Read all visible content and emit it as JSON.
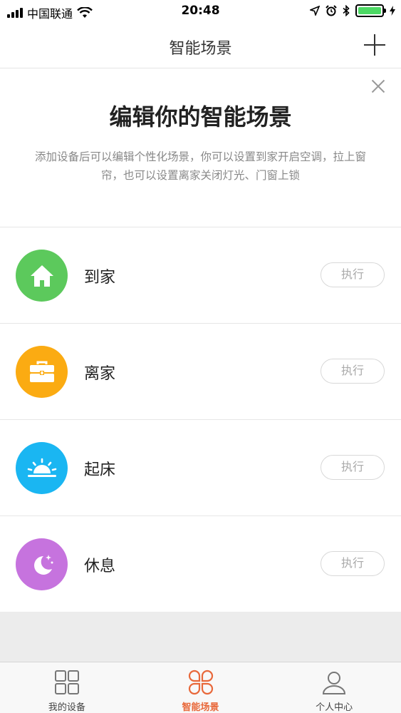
{
  "status_bar": {
    "carrier": "中国联通",
    "time": "20:48",
    "battery_color": "#4cd964"
  },
  "nav": {
    "title": "智能场景",
    "add_icon": "plus-icon"
  },
  "intro": {
    "title": "编辑你的智能场景",
    "description": "添加设备后可以编辑个性化场景，你可以设置到家开启空调，拉上窗帘，也可以设置离家关闭灯光、门窗上锁",
    "close_icon": "close-icon"
  },
  "scenes": [
    {
      "name": "到家",
      "action": "执行",
      "icon": "home-icon",
      "color": "#5cc95c"
    },
    {
      "name": "离家",
      "action": "执行",
      "icon": "briefcase-icon",
      "color": "#fbab12"
    },
    {
      "name": "起床",
      "action": "执行",
      "icon": "sunrise-icon",
      "color": "#1ab6f2"
    },
    {
      "name": "休息",
      "action": "执行",
      "icon": "moon-icon",
      "color": "#c673de"
    }
  ],
  "tabs": [
    {
      "label": "我的设备",
      "icon": "grid-icon",
      "active": false
    },
    {
      "label": "智能场景",
      "icon": "clover-icon",
      "active": true
    },
    {
      "label": "个人中心",
      "icon": "user-icon",
      "active": false
    }
  ],
  "accent_color": "#e8683a"
}
